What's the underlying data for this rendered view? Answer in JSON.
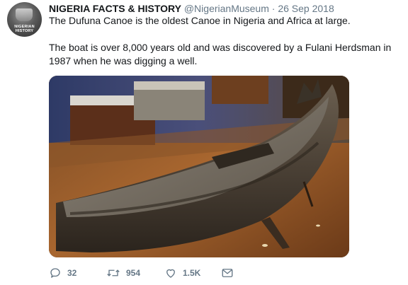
{
  "tweet": {
    "account_name": "NIGERIA FACTS & HISTORY",
    "handle": "@NigerianMuseum",
    "separator": "·",
    "date": "26 Sep 2018",
    "avatar_text": "NIGERIAN HISTORY",
    "text_line1": "The Dufuna Canoe is the oldest Canoe in Nigeria and Africa at large.",
    "text_line2": "The boat is over 8,000 years old and was discovered by a Fulani Herdsman in 1987 when he was digging a well.",
    "actions": {
      "replies": "32",
      "retweets": "954",
      "likes": "1.5K"
    }
  },
  "icons": {
    "reply": "reply-icon",
    "retweet": "retweet-icon",
    "like": "heart-icon",
    "dm": "envelope-icon"
  },
  "colors": {
    "text": "#14171a",
    "secondary": "#657786"
  }
}
